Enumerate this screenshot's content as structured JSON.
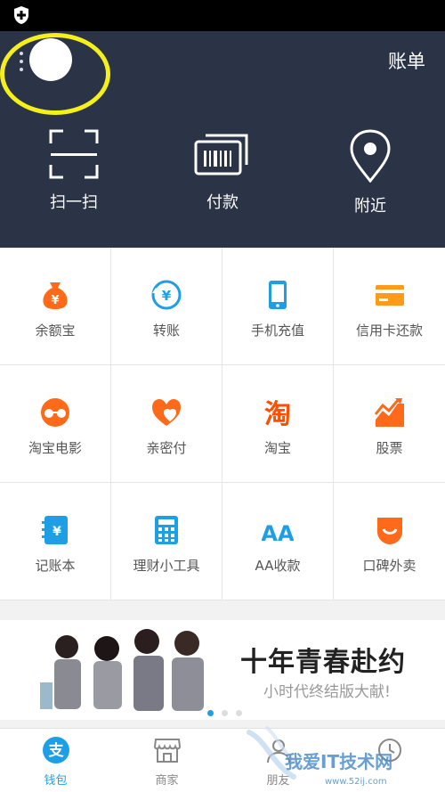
{
  "header": {
    "bill_label": "账单",
    "actions": [
      {
        "label": "扫一扫",
        "icon": "scan-icon"
      },
      {
        "label": "付款",
        "icon": "payment-code-icon"
      },
      {
        "label": "附近",
        "icon": "location-pin-icon"
      }
    ]
  },
  "grid": {
    "items": [
      {
        "label": "余额宝",
        "icon": "money-bag-icon"
      },
      {
        "label": "转账",
        "icon": "transfer-icon"
      },
      {
        "label": "手机充值",
        "icon": "phone-recharge-icon"
      },
      {
        "label": "信用卡还款",
        "icon": "credit-card-icon"
      },
      {
        "label": "淘宝电影",
        "icon": "movie-glasses-icon"
      },
      {
        "label": "亲密付",
        "icon": "hearts-icon"
      },
      {
        "label": "淘宝",
        "icon": "taobao-icon"
      },
      {
        "label": "股票",
        "icon": "stock-chart-icon"
      },
      {
        "label": "记账本",
        "icon": "account-book-icon"
      },
      {
        "label": "理财小工具",
        "icon": "calculator-icon"
      },
      {
        "label": "AA收款",
        "icon": "aa-icon"
      },
      {
        "label": "口碑外卖",
        "icon": "takeaway-icon"
      }
    ]
  },
  "banner": {
    "title": "十年青春赴约",
    "subtitle": "小时代终结版大献!"
  },
  "tabs": [
    {
      "label": "钱包",
      "icon": "wallet-icon",
      "active": true
    },
    {
      "label": "商家",
      "icon": "store-icon",
      "active": false
    },
    {
      "label": "朋友",
      "icon": "friends-icon",
      "active": false
    }
  ],
  "watermark": {
    "text": "我爱IT技术网",
    "url": "www.52ij.com"
  },
  "colors": {
    "header_bg": "#2b3347",
    "accent_blue": "#1e9fe5",
    "accent_orange": "#ff6a1a",
    "highlight_yellow": "#f5ef1a"
  }
}
